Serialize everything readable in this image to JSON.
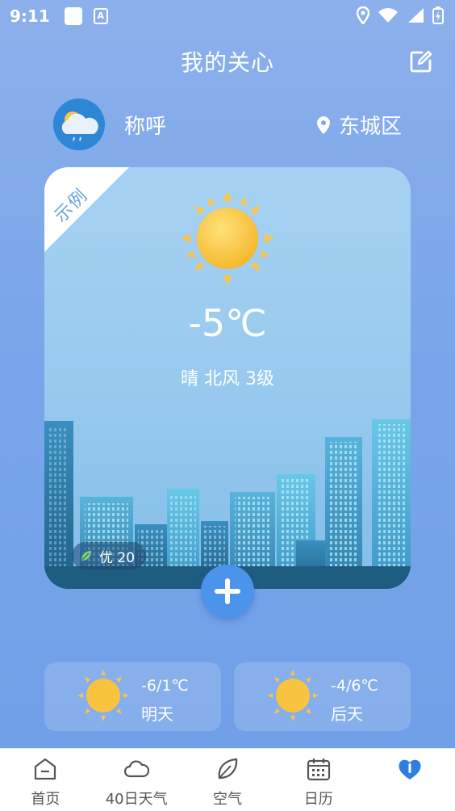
{
  "status_bar": {
    "time": "9:11",
    "badge": "A"
  },
  "header": {
    "title": "我的关心",
    "edit_icon": "edit-icon"
  },
  "profile": {
    "nickname": "称呼",
    "location": "东城区",
    "avatar_icon": "cloud-rain-icon"
  },
  "card": {
    "ribbon": "示例",
    "temperature": "-5℃",
    "condition": "晴 北风 3级",
    "aqi": "优 20",
    "weather_icon": "sun-icon"
  },
  "forecast": [
    {
      "range": "-6/1℃",
      "day": "明天",
      "icon": "sun-icon"
    },
    {
      "range": "-4/6℃",
      "day": "后天",
      "icon": "sun-icon"
    }
  ],
  "nav": [
    {
      "label": "首页",
      "icon": "home-icon"
    },
    {
      "label": "40日天气",
      "icon": "cloud-icon"
    },
    {
      "label": "空气",
      "icon": "leaf-icon"
    },
    {
      "label": "日历",
      "icon": "calendar-icon"
    },
    {
      "label": "",
      "icon": "care-icon",
      "active": true
    }
  ],
  "colors": {
    "accent": "#4c93ec",
    "background": "#7aa6ea",
    "sun": "#f9c843"
  }
}
